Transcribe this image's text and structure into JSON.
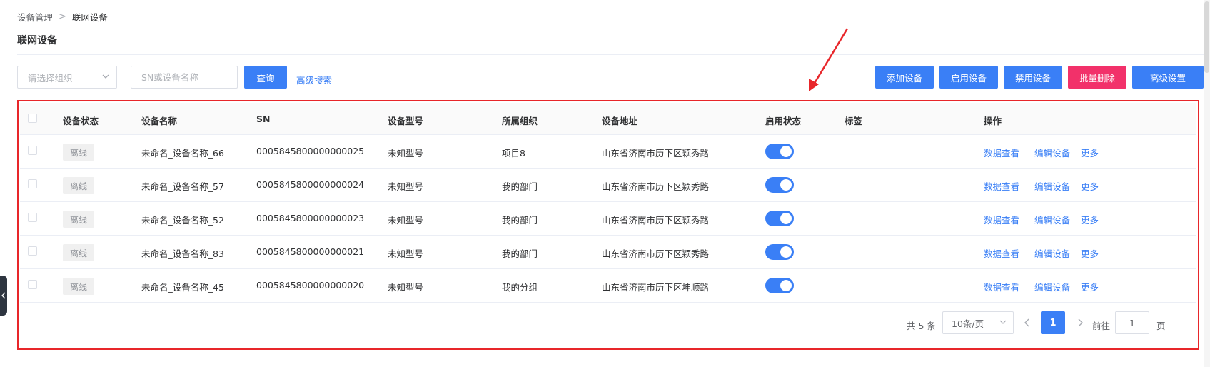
{
  "breadcrumb": {
    "root": "设备管理",
    "separator": ">",
    "current": "联网设备"
  },
  "page_title": "联网设备",
  "filters": {
    "org_placeholder": "请选择组织",
    "search_placeholder": "SN或设备名称",
    "query_label": "查询",
    "advanced_search_label": "高级搜索"
  },
  "actions": {
    "add": "添加设备",
    "enable": "启用设备",
    "disable": "禁用设备",
    "batch_delete": "批量删除",
    "advanced_settings": "高级设置"
  },
  "table": {
    "headers": {
      "status": "设备状态",
      "name": "设备名称",
      "sn": "SN",
      "model": "设备型号",
      "org": "所属组织",
      "address": "设备地址",
      "enabled": "启用状态",
      "tags": "标签",
      "ops": "操作"
    },
    "rows": [
      {
        "status": "离线",
        "name": "未命名_设备名称_66",
        "sn": "0005845800000000025",
        "model": "未知型号",
        "org": "项目8",
        "address": "山东省济南市历下区颖秀路",
        "enabled": true,
        "tags": ""
      },
      {
        "status": "离线",
        "name": "未命名_设备名称_57",
        "sn": "0005845800000000024",
        "model": "未知型号",
        "org": "我的部门",
        "address": "山东省济南市历下区颖秀路",
        "enabled": true,
        "tags": ""
      },
      {
        "status": "离线",
        "name": "未命名_设备名称_52",
        "sn": "0005845800000000023",
        "model": "未知型号",
        "org": "我的部门",
        "address": "山东省济南市历下区颖秀路",
        "enabled": true,
        "tags": ""
      },
      {
        "status": "离线",
        "name": "未命名_设备名称_83",
        "sn": "0005845800000000021",
        "model": "未知型号",
        "org": "我的部门",
        "address": "山东省济南市历下区颖秀路",
        "enabled": true,
        "tags": ""
      },
      {
        "status": "离线",
        "name": "未命名_设备名称_45",
        "sn": "0005845800000000020",
        "model": "未知型号",
        "org": "我的分组",
        "address": "山东省济南市历下区坤顺路",
        "enabled": true,
        "tags": ""
      }
    ],
    "op_labels": {
      "view": "数据查看",
      "edit": "编辑设备",
      "more": "更多"
    }
  },
  "pagination": {
    "total": "共 5 条",
    "page_size": "10条/页",
    "current_page": "1",
    "goto_label": "前往",
    "goto_value": "1",
    "page_suffix": "页"
  },
  "colors": {
    "primary": "#3a7ff6",
    "danger": "#f2316a",
    "annotation": "#e8262a"
  },
  "icons": [
    "chevron-down-icon",
    "chevron-left-icon",
    "chevron-right-icon",
    "collapse-arrow-icon"
  ]
}
